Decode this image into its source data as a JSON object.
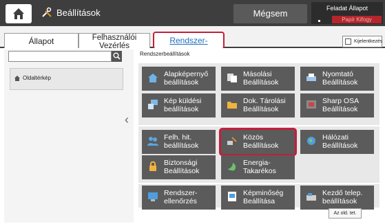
{
  "header": {
    "title": "Beállítások",
    "cancel_label": "Mégsem",
    "job_status_label": "Feladat Állapot",
    "job_status_sub": "Papír Kifogy"
  },
  "tabs": {
    "status": "Állapot",
    "user_control": "Felhasználói Vezérlés",
    "system": "Rendszer-",
    "logout": "Kijelentkezés"
  },
  "sidebar": {
    "search_placeholder": "",
    "sitemap_label": "Oldaltérkép"
  },
  "main": {
    "breadcrumb": "Rendszerbeállítások",
    "tiles": [
      {
        "label": "Alapképernyő beállítások",
        "icon": "home-icon"
      },
      {
        "label": "Másolási Beállítások",
        "icon": "copy-icon"
      },
      {
        "label": "Nyomtató Beállítások",
        "icon": "printer-icon"
      },
      {
        "label": "Kép küldési beállítások",
        "icon": "image-send-icon"
      },
      {
        "label": "Dok. Tárolási Beállítások",
        "icon": "folder-icon"
      },
      {
        "label": "Sharp OSA Beállítások",
        "icon": "osa-icon"
      },
      {
        "label": "Felh. hit. beállítások",
        "icon": "users-icon"
      },
      {
        "label": "Közös Beállítások",
        "icon": "common-settings-icon"
      },
      {
        "label": "Hálózati Beállítások",
        "icon": "globe-icon"
      },
      {
        "label": "Biztonsági Beállítások",
        "icon": "lock-icon"
      },
      {
        "label": "Energia-Takarékos",
        "icon": "leaf-icon"
      },
      {
        "label": "Rendszer-ellenőrzés",
        "icon": "monitor-icon"
      },
      {
        "label": "Képminőség Beállítása",
        "icon": "image-quality-icon"
      },
      {
        "label": "Kezdő telep. beállítások",
        "icon": "initial-setup-icon"
      }
    ],
    "page_button": "Az old. tet."
  },
  "colors": {
    "header_bg": "#3e3e3e",
    "tile_bg": "#5b5b5b",
    "highlight": "#c41e3a",
    "link_blue": "#1d6fbf",
    "status_red": "#b4262c"
  }
}
